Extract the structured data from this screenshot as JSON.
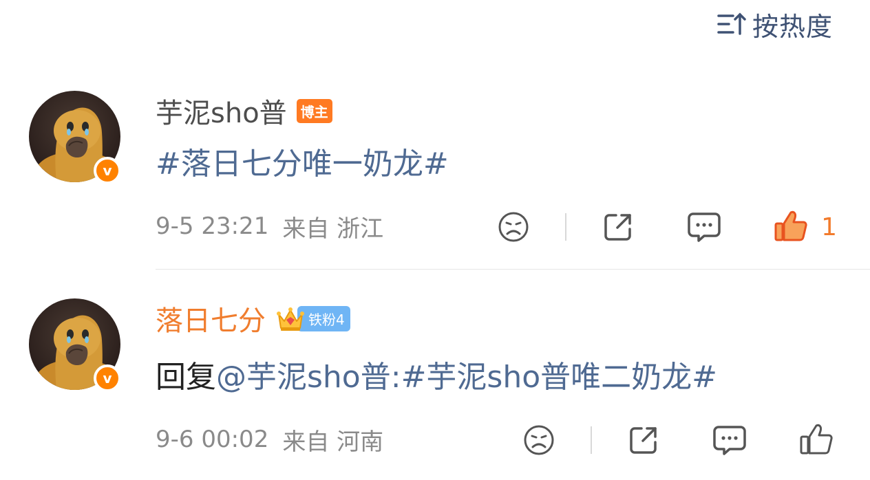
{
  "sort": {
    "label": "按热度",
    "icon": "sort-icon"
  },
  "comments": [
    {
      "username": "芋泥sho普",
      "badge": "博主",
      "verified_icon": "verified-v-icon",
      "verify_mark": "v",
      "content": {
        "text": "#落日七分唯一奶龙#"
      },
      "timestamp": "9-5 23:21",
      "location": "来自 浙江",
      "like_count": "1",
      "liked": true
    },
    {
      "username": "落日七分",
      "fan_badge": "铁粉4",
      "verified_icon": "verified-v-icon",
      "verify_mark": "v",
      "content": {
        "prefix": "回复",
        "mention": "@芋泥sho普",
        "colon": ":",
        "hashtag": "#芋泥sho普唯二奶龙#"
      },
      "timestamp": "9-6 00:02",
      "location": "来自 河南",
      "liked": false
    }
  ],
  "colors": {
    "link": "#4f6a92",
    "orange": "#f07d2e",
    "like": "#f27b2c",
    "meta": "#8a8a8a"
  }
}
